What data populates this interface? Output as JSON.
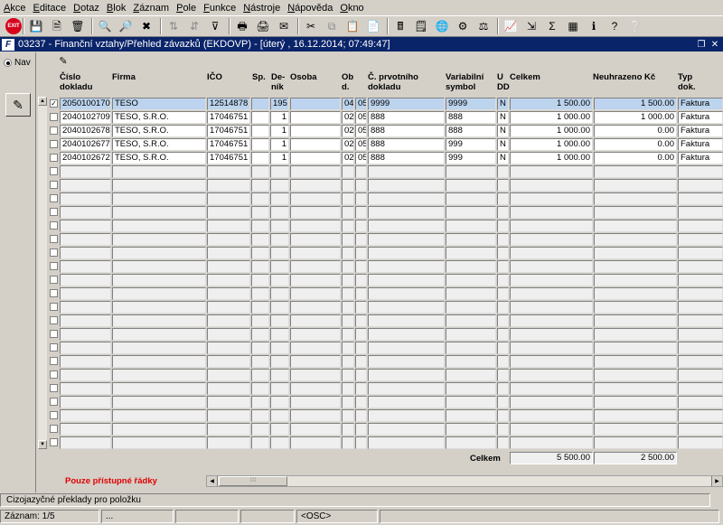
{
  "menu": [
    "Akce",
    "Editace",
    "Dotaz",
    "Blok",
    "Záznam",
    "Pole",
    "Funkce",
    "Nástroje",
    "Nápověda",
    "Okno"
  ],
  "toolbar": {
    "exit_label": "EXIT"
  },
  "window": {
    "title": "03237 - Finanční vztahy/Přehled závazků (EKDOVP) - [úterý  , 16.12.2014; 07:49:47]"
  },
  "nav": {
    "label": "Nav"
  },
  "columns": {
    "cislo": "Číslo\ndokladu",
    "firma": "Firma",
    "ico": "IČO",
    "sp": "Sp.",
    "denik": "De-\nník",
    "osoba": "Osoba",
    "obd": "Ob\nd.",
    "cprv": "Č. prvotního\ndokladu",
    "vs": "Variabilní\nsymbol",
    "udd": "U\nDD",
    "celkem": "Celkem",
    "neuhr": "Neuhrazeno Kč",
    "typ": "Typ\ndok."
  },
  "rows": [
    {
      "checked": true,
      "cislo": "2050100170",
      "firma": "TESO",
      "ico": "12514878",
      "sp": "",
      "denik": "195",
      "osoba": "",
      "ob1": "04",
      "ob2": "05",
      "cprv": "9999",
      "vs": "9999",
      "u": "N",
      "celkem": "1 500.00",
      "neuhr": "1 500.00",
      "typ": "Faktura"
    },
    {
      "checked": false,
      "cislo": "2040102709",
      "firma": "TESO, S.R.O.",
      "ico": "17046751",
      "sp": "",
      "denik": "1",
      "osoba": "",
      "ob1": "02",
      "ob2": "05",
      "cprv": "888",
      "vs": "888",
      "u": "N",
      "celkem": "1 000.00",
      "neuhr": "1 000.00",
      "typ": "Faktura"
    },
    {
      "checked": false,
      "cislo": "2040102678",
      "firma": "TESO, S.R.O.",
      "ico": "17046751",
      "sp": "",
      "denik": "1",
      "osoba": "",
      "ob1": "02",
      "ob2": "05",
      "cprv": "888",
      "vs": "888",
      "u": "N",
      "celkem": "1 000.00",
      "neuhr": "0.00",
      "typ": "Faktura"
    },
    {
      "checked": false,
      "cislo": "2040102677",
      "firma": "TESO, S.R.O.",
      "ico": "17046751",
      "sp": "",
      "denik": "1",
      "osoba": "",
      "ob1": "02",
      "ob2": "05",
      "cprv": "888",
      "vs": "999",
      "u": "N",
      "celkem": "1 000.00",
      "neuhr": "0.00",
      "typ": "Faktura"
    },
    {
      "checked": false,
      "cislo": "2040102672",
      "firma": "TESO, S.R.O.",
      "ico": "17046751",
      "sp": "",
      "denik": "1",
      "osoba": "",
      "ob1": "02",
      "ob2": "05",
      "cprv": "888",
      "vs": "999",
      "u": "N",
      "celkem": "1 000.00",
      "neuhr": "0.00",
      "typ": "Faktura"
    }
  ],
  "totals": {
    "label": "Celkem",
    "celkem": "5 500.00",
    "neuhr": "2 500.00"
  },
  "access_note": "Pouze přístupné řádky",
  "hint": "Cizojazyčné překlady pro položku",
  "status": {
    "record": "Záznam: 1/5",
    "s2": "...",
    "mode": "<OSC>"
  }
}
